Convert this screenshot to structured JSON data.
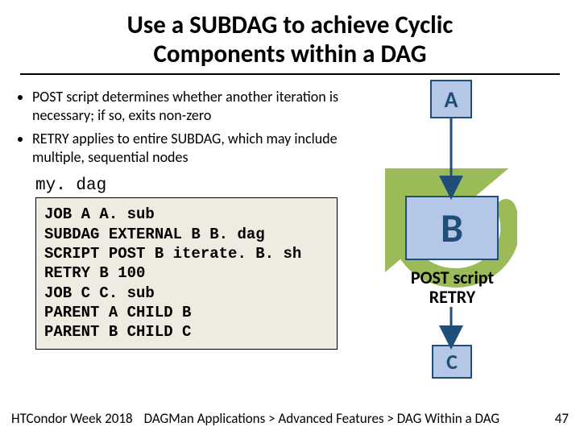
{
  "title_line1": "Use a SUBDAG to achieve Cyclic",
  "title_line2": "Components within a DAG",
  "bullets": [
    "POST script determines whether another iteration is necessary; if so, exits non-zero",
    "RETRY applies to entire SUBDAG, which may include multiple, sequential nodes"
  ],
  "dag_filename": "my. dag",
  "code_lines": [
    "JOB A A. sub",
    "SUBDAG EXTERNAL B B. dag",
    "SCRIPT POST B iterate. B. sh",
    "RETRY B 100",
    "JOB C C. sub",
    "PARENT A CHILD B",
    "PARENT B CHILD C"
  ],
  "nodes": {
    "a": "A",
    "b": "B",
    "c": "C"
  },
  "post_label_l1": "POST script",
  "post_label_l2": "RETRY",
  "footer": {
    "event": "HTCondor Week 2018",
    "breadcrumb": "DAGMan Applications > Advanced Features > DAG Within a DAG",
    "page": "47"
  },
  "colors": {
    "node_border": "#1f4e79",
    "ring": "#9bbb59"
  }
}
